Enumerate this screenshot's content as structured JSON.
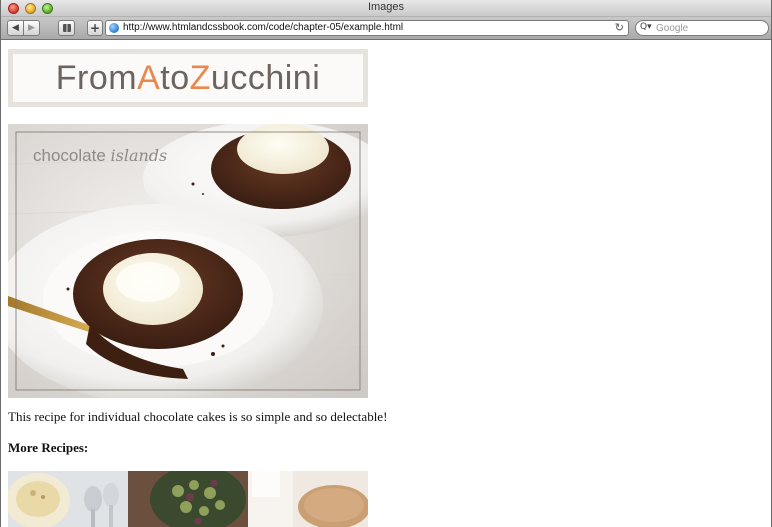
{
  "window": {
    "title": "Images"
  },
  "toolbar": {
    "url": "http://www.htmlandcssbook.com/code/chapter-05/example.html",
    "search_placeholder": "Google"
  },
  "page": {
    "logo": {
      "part1": "From ",
      "accent1": "A",
      "part2": " to ",
      "accent2": "Z",
      "part3": "ucchini"
    },
    "hero_caption": {
      "word1": "chocolate ",
      "word2": "islands"
    },
    "description": "This recipe for individual chocolate cakes is so simple and so delectable!",
    "more_heading": "More Recipes:"
  }
}
